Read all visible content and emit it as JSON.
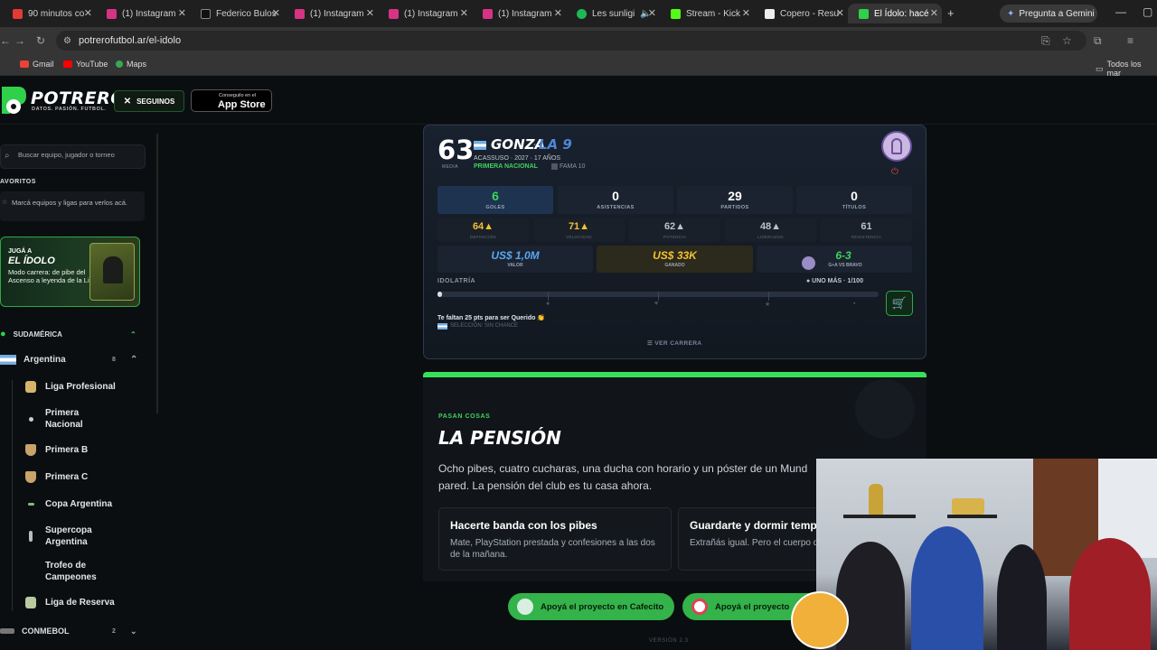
{
  "browser": {
    "tabs": [
      {
        "title": "90 minutos co",
        "color": "#e53935"
      },
      {
        "title": "(1) Instagram",
        "color": "#d63384"
      },
      {
        "title": "Federico Bulos",
        "color": "#111111"
      },
      {
        "title": "(1) Instagram",
        "color": "#d63384"
      },
      {
        "title": "(1) Instagram",
        "color": "#d63384"
      },
      {
        "title": "(1) Instagram",
        "color": "#d63384"
      },
      {
        "title": "Les sunligi",
        "color": "#1db954"
      },
      {
        "title": "Stream - Kick",
        "color": "#53fc18"
      },
      {
        "title": "Copero - Resu",
        "color": "#eeeeee"
      },
      {
        "title": "El Ídolo: hacé",
        "color": "#2fd14a"
      }
    ],
    "gemini_label": "Pregunta a Gemini",
    "url": "potrerofutbol.ar/el-idolo",
    "bookmarks": [
      "Gmail",
      "YouTube",
      "Maps"
    ],
    "all_bookmarks": "Todos los mar"
  },
  "site": {
    "logo": "POTRERO",
    "tagline": "DATOS. PASIÓN. FUTBOL.",
    "x_button": "SEGUINOS",
    "appstore_small": "Conseguilo en el",
    "appstore_big": "App Store"
  },
  "sidebar": {
    "search_placeholder": "Buscar equipo, jugador o torneo",
    "favorites_title": "AVORITOS",
    "favorites_text": "Marcá equipos y ligas para verlos acá.",
    "promo": {
      "line1": "JUGÁ A",
      "line2": "EL ÍDOLO",
      "line3": "Modo carrera: de pibe del Ascenso a leyenda de la Liga"
    },
    "region": "SUDAMÉRICA",
    "country": "Argentina",
    "country_count": "8",
    "items": [
      {
        "label": "Liga Profesional"
      },
      {
        "label": "Primera Nacional"
      },
      {
        "label": "Primera B"
      },
      {
        "label": "Primera C"
      },
      {
        "label": "Copa Argentina"
      },
      {
        "label": "Supercopa Argentina"
      },
      {
        "label": "Trofeo de Campeones"
      },
      {
        "label": "Liga de Reserva"
      }
    ],
    "conmebol": "CONMEBOL",
    "conmebol_count": "2"
  },
  "player": {
    "media": "63",
    "media_label": "MEDIA",
    "name": "GONZA",
    "separator": "·",
    "nickname": "LA 9",
    "club_line": "ACASSUSO · 2027 · 17 AÑOS",
    "league": "PRIMERA NACIONAL",
    "fama": "FAMA 10",
    "stats": [
      {
        "value": "6",
        "label": "GOLES"
      },
      {
        "value": "0",
        "label": "ASISTENCIAS"
      },
      {
        "value": "29",
        "label": "PARTIDOS"
      },
      {
        "value": "0",
        "label": "TÍTULOS"
      }
    ],
    "attributes": [
      {
        "value": "64▲",
        "label": "DEFINICIÓN",
        "color": "#f2c230"
      },
      {
        "value": "71▲",
        "label": "VELOCIDAD",
        "color": "#f2c230"
      },
      {
        "value": "62▲",
        "label": "POTENCIA",
        "color": "#b9c2cc"
      },
      {
        "value": "48▲",
        "label": "LIDERAZGO",
        "color": "#b9c2cc"
      },
      {
        "value": "61",
        "label": "RESISTENCIA",
        "color": "#b9c2cc"
      }
    ],
    "valor": {
      "value": "US$ 1,0M",
      "label": "VALOR"
    },
    "ganado": {
      "value": "US$ 33K",
      "label": "GANADO"
    },
    "last_match": {
      "value": "6-3",
      "label": "G+A VS BRAVO"
    },
    "idolatria_label": "IDOLATRÍA",
    "idolatria_right": "● UNO MÁS · 1/100",
    "idolatria_progress": 0.01,
    "missing": "Te faltan 25 pts para ser Querido 👏",
    "seleccion": "SELECCIÓN: SIN CHANCE",
    "ver_carrera": "☰ VER CARRERA"
  },
  "story": {
    "kicker": "PASAN COSAS",
    "title": "LA PENSIÓN",
    "body": "Ocho pibes, cuatro cucharas, una ducha con horario y un póster de un Mund pared. La pensión del club es tu casa ahora.",
    "choices": [
      {
        "title": "Hacerte banda con los pibes",
        "desc": "Mate, PlayStation prestada y confesiones a las dos de la mañana."
      },
      {
        "title": "Guardarte y dormir temp",
        "desc": "Extrañás igual. Pero el cuerpo durmiendo."
      }
    ]
  },
  "footer": {
    "cafecito": "Apoyá el proyecto en Cafecito",
    "other": "Apoyá el proyecto",
    "version": "VERSIÓN 2.3"
  }
}
